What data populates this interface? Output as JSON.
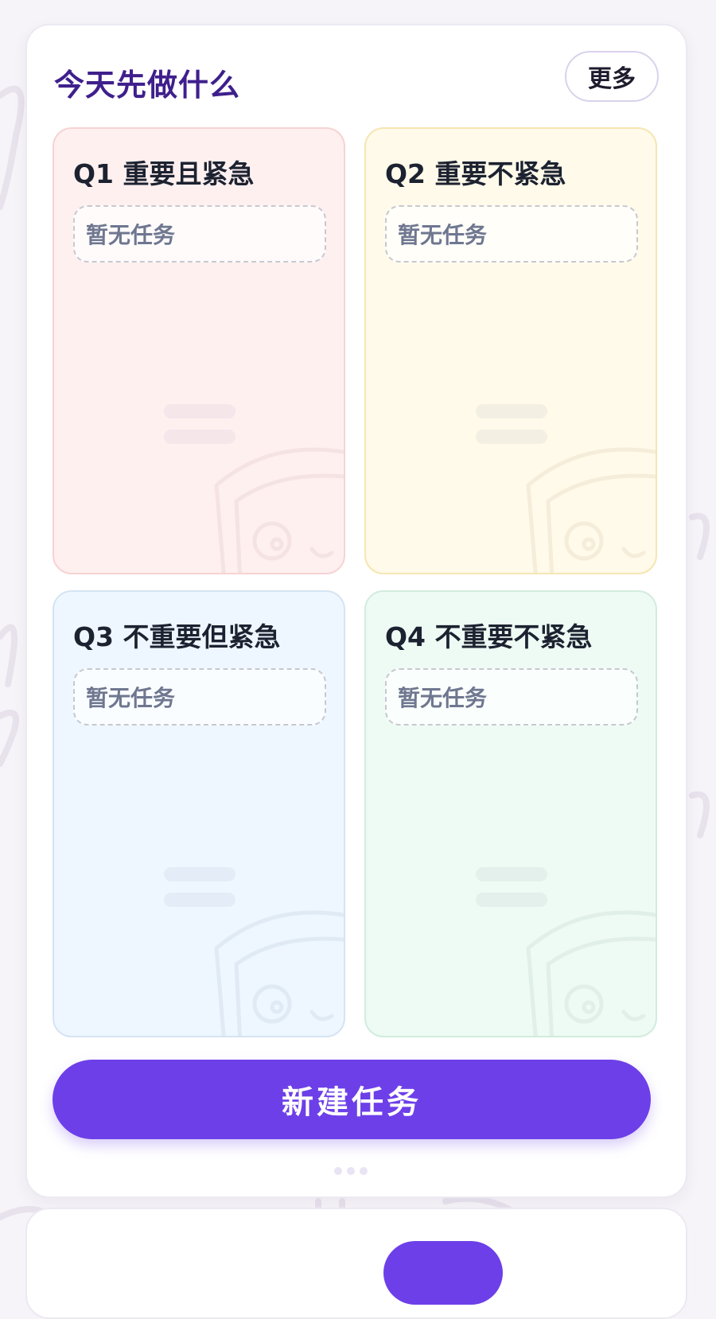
{
  "card": {
    "title": "今天先做什么",
    "more_label": "更多"
  },
  "quadrants": [
    {
      "title": "Q1 重要且紧急",
      "empty_text": "暂无任务",
      "bg": "#fff0f0"
    },
    {
      "title": "Q2 重要不紧急",
      "empty_text": "暂无任务",
      "bg": "#fffaea"
    },
    {
      "title": "Q3 不重要但紧急",
      "empty_text": "暂无任务",
      "bg": "#eef7ff"
    },
    {
      "title": "Q4 不重要不紧急",
      "empty_text": "暂无任务",
      "bg": "#eefbf4"
    }
  ],
  "new_task_label": "新建任务",
  "colors": {
    "title_purple": "#3f1f8c",
    "primary_button": "#6d3fe8"
  },
  "icons": {
    "drag": "drag-handle-icon",
    "mascot": "mascot-illustration"
  }
}
